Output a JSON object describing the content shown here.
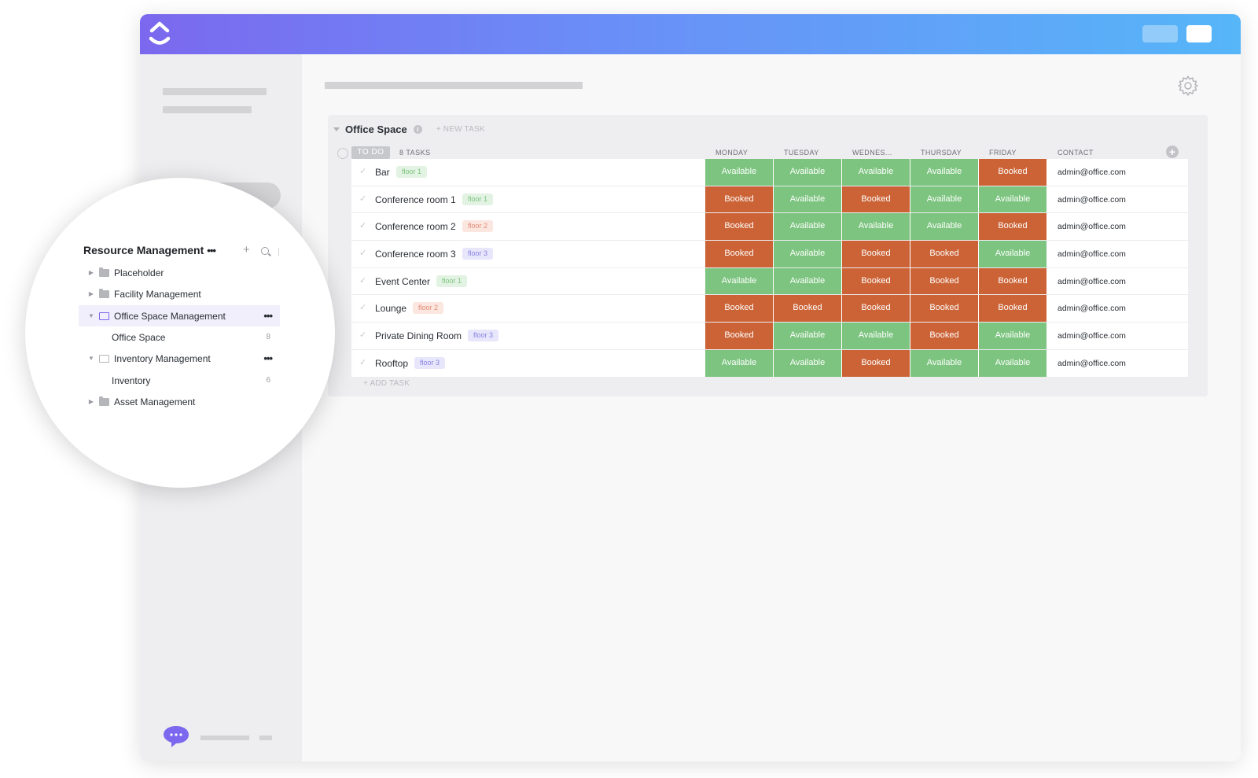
{
  "app": {
    "name": "ClickUp"
  },
  "main": {
    "group": {
      "title": "Office Space",
      "new_task_label": "+ NEW TASK",
      "status_label": "TO DO",
      "task_count": "8 TASKS",
      "add_task_label": "+ ADD TASK",
      "columns": [
        "MONDAY",
        "TUESDAY",
        "WEDNES...",
        "THURSDAY",
        "FRIDAY",
        "CONTACT"
      ],
      "rows": [
        {
          "name": "Bar",
          "tag": "floor 1",
          "tag_class": "floor1",
          "days": [
            "Available",
            "Available",
            "Available",
            "Available",
            "Booked"
          ],
          "contact": "admin@office.com"
        },
        {
          "name": "Conference room 1",
          "tag": "floor 1",
          "tag_class": "floor1",
          "days": [
            "Booked",
            "Available",
            "Booked",
            "Available",
            "Available"
          ],
          "contact": "admin@office.com"
        },
        {
          "name": "Conference room 2",
          "tag": "floor 2",
          "tag_class": "floor2",
          "days": [
            "Booked",
            "Available",
            "Available",
            "Available",
            "Booked"
          ],
          "contact": "admin@office.com"
        },
        {
          "name": "Conference room 3",
          "tag": "floor 3",
          "tag_class": "floor3",
          "days": [
            "Booked",
            "Available",
            "Booked",
            "Booked",
            "Available"
          ],
          "contact": "admin@office.com"
        },
        {
          "name": "Event Center",
          "tag": "floor 1",
          "tag_class": "floor1",
          "days": [
            "Available",
            "Available",
            "Booked",
            "Booked",
            "Booked"
          ],
          "contact": "admin@office.com"
        },
        {
          "name": "Lounge",
          "tag": "floor 2",
          "tag_class": "floor2",
          "days": [
            "Booked",
            "Booked",
            "Booked",
            "Booked",
            "Booked"
          ],
          "contact": "admin@office.com"
        },
        {
          "name": "Private Dining Room",
          "tag": "floor 3",
          "tag_class": "floor3",
          "days": [
            "Booked",
            "Available",
            "Available",
            "Booked",
            "Available"
          ],
          "contact": "admin@office.com"
        },
        {
          "name": "Rooftop",
          "tag": "floor 3",
          "tag_class": "floor3",
          "days": [
            "Available",
            "Available",
            "Booked",
            "Available",
            "Available"
          ],
          "contact": "admin@office.com"
        }
      ]
    }
  },
  "zoom": {
    "title": "Resource Management",
    "title_more": "•••",
    "add_icon": "+",
    "items": [
      {
        "label": "Placeholder",
        "type": "folder",
        "arrow": "▶",
        "level": 0,
        "count": "",
        "more": ""
      },
      {
        "label": "Facility Management",
        "type": "folder",
        "arrow": "▶",
        "level": 0,
        "count": "",
        "more": ""
      },
      {
        "label": "Office Space Management",
        "type": "folder-open",
        "arrow": "▼",
        "level": 0,
        "count": "",
        "more": "•••",
        "active": true
      },
      {
        "label": "Office Space",
        "type": "list",
        "arrow": "",
        "level": 1,
        "count": "8",
        "more": ""
      },
      {
        "label": "Inventory Management",
        "type": "folder-outline",
        "arrow": "▼",
        "level": 0,
        "count": "",
        "more": "•••"
      },
      {
        "label": "Inventory",
        "type": "list",
        "arrow": "",
        "level": 1,
        "count": "6",
        "more": ""
      },
      {
        "label": "Asset Management",
        "type": "folder",
        "arrow": "▶",
        "level": 0,
        "count": "",
        "more": ""
      }
    ]
  },
  "colors": {
    "available": "#7cc47f",
    "booked": "#cb6336",
    "accent": "#7b68ee"
  },
  "icons": {
    "logo": "clickup-logo-icon",
    "settings": "gear-icon",
    "chat": "chat-bubble-icon",
    "search": "search-icon",
    "info": "info-icon"
  }
}
